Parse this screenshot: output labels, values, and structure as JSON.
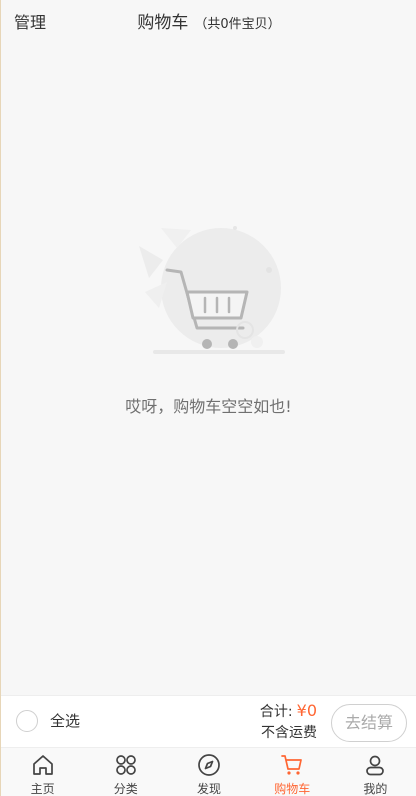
{
  "header": {
    "manage_label": "管理",
    "title": "购物车",
    "count_text": "（共0件宝贝）"
  },
  "empty": {
    "message": "哎呀，购物车空空如也!"
  },
  "footer": {
    "select_all_label": "全选",
    "total_label": "合计:",
    "total_amount": "¥0",
    "shipping_note": "不含运费",
    "checkout_label": "去结算"
  },
  "tabs": [
    {
      "label": "主页",
      "icon": "home-icon"
    },
    {
      "label": "分类",
      "icon": "category-icon"
    },
    {
      "label": "发现",
      "icon": "compass-icon"
    },
    {
      "label": "购物车",
      "icon": "cart-icon",
      "active": true
    },
    {
      "label": "我的",
      "icon": "user-icon"
    }
  ],
  "colors": {
    "accent": "#ff6633",
    "background": "#f7f7f7"
  }
}
